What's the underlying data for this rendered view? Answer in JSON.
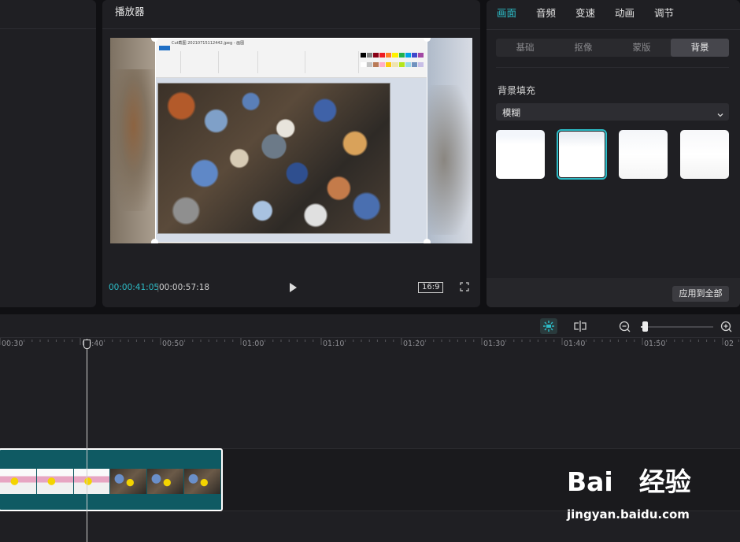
{
  "player": {
    "title": "播放器",
    "current_time": "00:00:41:05",
    "total_time": "00:00:57:18",
    "ratio": "16:9",
    "embedded_window_title": "Cut截图 20210715112442.jpeg - 画图"
  },
  "inspector": {
    "tabs": [
      {
        "label": "画面",
        "active": true
      },
      {
        "label": "音频",
        "active": false
      },
      {
        "label": "变速",
        "active": false
      },
      {
        "label": "动画",
        "active": false
      },
      {
        "label": "调节",
        "active": false
      }
    ],
    "subtabs": [
      {
        "label": "基础",
        "active": false
      },
      {
        "label": "抠像",
        "active": false
      },
      {
        "label": "蒙版",
        "active": false
      },
      {
        "label": "背景",
        "active": true
      }
    ],
    "fill_label": "背景填充",
    "fill_value": "模糊",
    "selected_thumbnail_index": 1,
    "apply_label": "应用到全部"
  },
  "timeline": {
    "ruler_labels": [
      "00:30",
      "00:40",
      "00:50",
      "01:00",
      "01:10",
      "01:20",
      "01:30",
      "01:40",
      "01:50",
      "02"
    ],
    "zoom_level": 0.05
  },
  "colors": {
    "accent": "#2dbdc8",
    "panel": "#1f1f23",
    "clip": "#0f5a63"
  },
  "watermark": {
    "brand": "Bai　经验",
    "url": "jingyan.baidu.com"
  }
}
